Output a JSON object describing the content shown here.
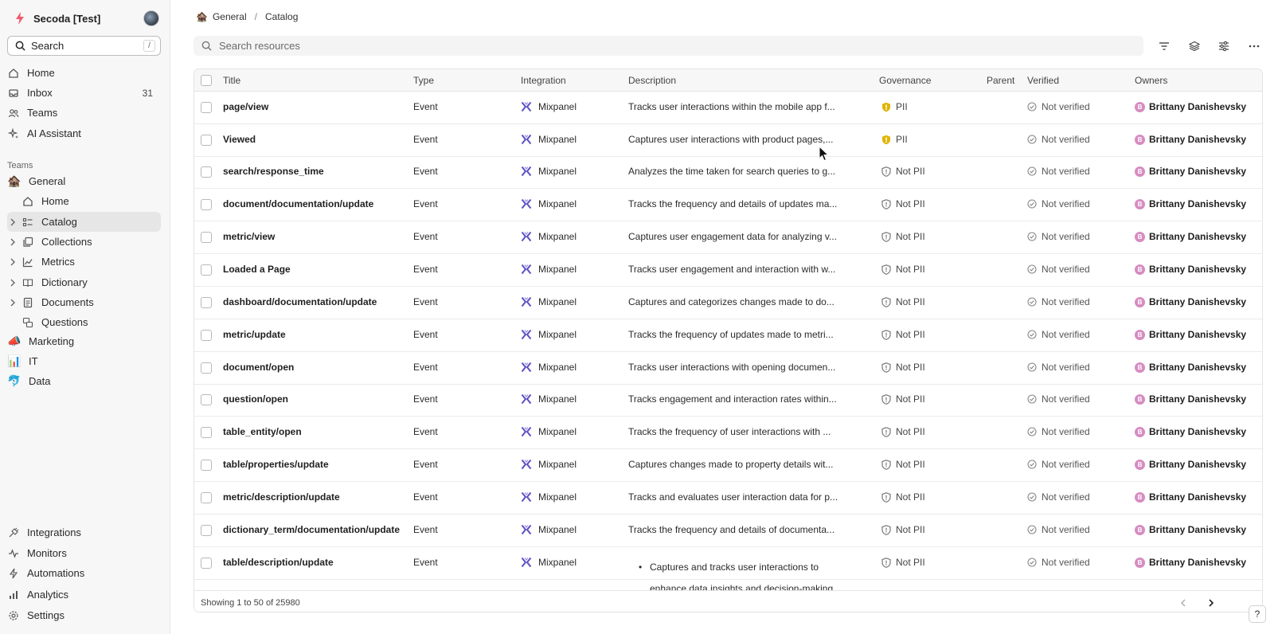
{
  "workspace": {
    "name": "Secoda [Test]"
  },
  "sidebar": {
    "search_label": "Search",
    "search_shortcut": "/",
    "top_items": [
      {
        "label": "Home",
        "icon": "home-icon"
      },
      {
        "label": "Inbox",
        "icon": "inbox-icon",
        "badge": "31"
      },
      {
        "label": "Teams",
        "icon": "users-icon"
      },
      {
        "label": "AI Assistant",
        "icon": "sparkle-icon"
      }
    ],
    "teams_heading": "Teams",
    "general": {
      "label": "General",
      "emoji": "🏚️"
    },
    "general_items": [
      {
        "label": "Home",
        "icon": "home-icon"
      },
      {
        "label": "Catalog",
        "icon": "catalog-icon",
        "active": true
      },
      {
        "label": "Collections",
        "icon": "collections-icon"
      },
      {
        "label": "Metrics",
        "icon": "metrics-icon"
      },
      {
        "label": "Dictionary",
        "icon": "book-icon"
      },
      {
        "label": "Documents",
        "icon": "document-icon"
      },
      {
        "label": "Questions",
        "icon": "questions-icon"
      }
    ],
    "other_teams": [
      {
        "label": "Marketing",
        "emoji": "📣"
      },
      {
        "label": "IT",
        "emoji": "📊"
      },
      {
        "label": "Data",
        "emoji": "🐬"
      }
    ],
    "bottom_items": [
      {
        "label": "Integrations",
        "icon": "plug-icon"
      },
      {
        "label": "Monitors",
        "icon": "pulse-icon"
      },
      {
        "label": "Automations",
        "icon": "bolt-icon"
      },
      {
        "label": "Analytics",
        "icon": "bar-chart-icon"
      },
      {
        "label": "Settings",
        "icon": "gear-icon"
      }
    ]
  },
  "breadcrumb": {
    "team": "General",
    "page": "Catalog"
  },
  "search": {
    "placeholder": "Search resources"
  },
  "table": {
    "columns": [
      "Title",
      "Type",
      "Integration",
      "Description",
      "Governance",
      "Parent",
      "Verified",
      "Owners"
    ],
    "rows": [
      {
        "title": "page/view",
        "type": "Event",
        "integration": "Mixpanel",
        "description": "Tracks user interactions within the mobile app f...",
        "governance": "PII",
        "verified": "Not verified",
        "owner": "Brittany Danishevsky",
        "owner_initial": "B"
      },
      {
        "title": "Viewed",
        "type": "Event",
        "integration": "Mixpanel",
        "description": "Captures user interactions with product pages,...",
        "governance": "PII",
        "verified": "Not verified",
        "owner": "Brittany Danishevsky",
        "owner_initial": "B"
      },
      {
        "title": "search/response_time",
        "type": "Event",
        "integration": "Mixpanel",
        "description": "Analyzes the time taken for search queries to g...",
        "governance": "Not PII",
        "verified": "Not verified",
        "owner": "Brittany Danishevsky",
        "owner_initial": "B"
      },
      {
        "title": "document/documentation/update",
        "type": "Event",
        "integration": "Mixpanel",
        "description": "Tracks the frequency and details of updates ma...",
        "governance": "Not PII",
        "verified": "Not verified",
        "owner": "Brittany Danishevsky",
        "owner_initial": "B"
      },
      {
        "title": "metric/view",
        "type": "Event",
        "integration": "Mixpanel",
        "description": "Captures user engagement data for analyzing v...",
        "governance": "Not PII",
        "verified": "Not verified",
        "owner": "Brittany Danishevsky",
        "owner_initial": "B"
      },
      {
        "title": "Loaded a Page",
        "type": "Event",
        "integration": "Mixpanel",
        "description": "Tracks user engagement and interaction with w...",
        "governance": "Not PII",
        "verified": "Not verified",
        "owner": "Brittany Danishevsky",
        "owner_initial": "B"
      },
      {
        "title": "dashboard/documentation/update",
        "type": "Event",
        "integration": "Mixpanel",
        "description": "Captures and categorizes changes made to do...",
        "governance": "Not PII",
        "verified": "Not verified",
        "owner": "Brittany Danishevsky",
        "owner_initial": "B"
      },
      {
        "title": "metric/update",
        "type": "Event",
        "integration": "Mixpanel",
        "description": "Tracks the frequency of updates made to metri...",
        "governance": "Not PII",
        "verified": "Not verified",
        "owner": "Brittany Danishevsky",
        "owner_initial": "B"
      },
      {
        "title": "document/open",
        "type": "Event",
        "integration": "Mixpanel",
        "description": "Tracks user interactions with opening documen...",
        "governance": "Not PII",
        "verified": "Not verified",
        "owner": "Brittany Danishevsky",
        "owner_initial": "B"
      },
      {
        "title": "question/open",
        "type": "Event",
        "integration": "Mixpanel",
        "description": "Tracks engagement and interaction rates within...",
        "governance": "Not PII",
        "verified": "Not verified",
        "owner": "Brittany Danishevsky",
        "owner_initial": "B"
      },
      {
        "title": "table_entity/open",
        "type": "Event",
        "integration": "Mixpanel",
        "description": "Tracks the frequency of user interactions with ...",
        "governance": "Not PII",
        "verified": "Not verified",
        "owner": "Brittany Danishevsky",
        "owner_initial": "B"
      },
      {
        "title": "table/properties/update",
        "type": "Event",
        "integration": "Mixpanel",
        "description": "Captures changes made to property details wit...",
        "governance": "Not PII",
        "verified": "Not verified",
        "owner": "Brittany Danishevsky",
        "owner_initial": "B"
      },
      {
        "title": "metric/description/update",
        "type": "Event",
        "integration": "Mixpanel",
        "description": "Tracks and evaluates user interaction data for p...",
        "governance": "Not PII",
        "verified": "Not verified",
        "owner": "Brittany Danishevsky",
        "owner_initial": "B"
      },
      {
        "title": "dictionary_term/documentation/update",
        "type": "Event",
        "integration": "Mixpanel",
        "description": "Tracks the frequency and details of documenta...",
        "governance": "Not PII",
        "verified": "Not verified",
        "owner": "Brittany Danishevsky",
        "owner_initial": "B"
      },
      {
        "title": "table/description/update",
        "type": "Event",
        "integration": "Mixpanel",
        "description": "",
        "description_bullet": [
          "Captures and tracks user interactions to",
          "enhance data insights and decision-making"
        ],
        "governance": "Not PII",
        "verified": "Not verified",
        "owner": "Brittany Danishevsky",
        "owner_initial": "B"
      }
    ]
  },
  "footer": {
    "info": "Showing 1 to 50 of 25980"
  },
  "help_label": "?",
  "colors": {
    "pii_shield": "#e0b400",
    "owner_avatar": "#d68cc2",
    "mixpanel": "#5b4fc4",
    "active_bg": "#e6e6e6"
  }
}
